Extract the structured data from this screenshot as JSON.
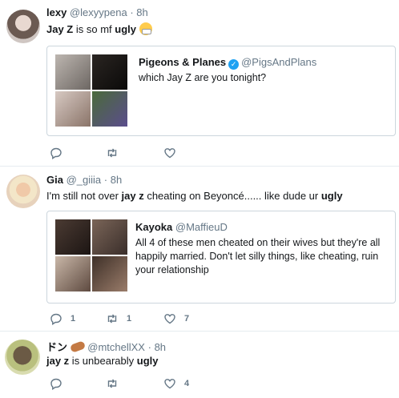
{
  "tweets": [
    {
      "name": "lexy",
      "handle": "@lexyypena",
      "dot": "·",
      "time": "8h",
      "text_pre": "Jay Z",
      "text_mid": " is so mf ",
      "text_bold2": "ugly",
      "emoji": "mask-face-emoji",
      "quote": {
        "name": "Pigeons & Planes",
        "handle": "@PigsAndPlans",
        "text": "which Jay Z are you tonight?",
        "verified": true
      },
      "actions": {
        "reply": "",
        "retweet": "",
        "like": ""
      }
    },
    {
      "name": "Gia",
      "handle": "@_giiia",
      "dot": "·",
      "time": "8h",
      "text_pre": "I'm still not over ",
      "text_bold1": "jay z",
      "text_mid": " cheating on Beyoncé...... like dude ur ",
      "text_bold2": "ugly",
      "quote": {
        "name": "Kayoka",
        "handle": "@MaffieuD",
        "text_lines": [
          "All 4 of these men cheated on their wives but they're all",
          "happily married. Don't let silly things, like cheating, ruin",
          "your relationship"
        ]
      },
      "actions": {
        "reply": "1",
        "retweet": "1",
        "like": "7"
      }
    },
    {
      "name": "ドン",
      "handle": "@mtchellXX",
      "dot": "·",
      "time": "8h",
      "text_bold1": "jay z",
      "text_mid": " is unbearably ",
      "text_bold2": "ugly",
      "emoji": "peanut-emoji",
      "actions": {
        "reply": "",
        "retweet": "",
        "like": "4"
      }
    }
  ],
  "colors": {
    "secondary_text": "#657786",
    "border": "#e6ecf0",
    "verified": "#1da1f2"
  }
}
